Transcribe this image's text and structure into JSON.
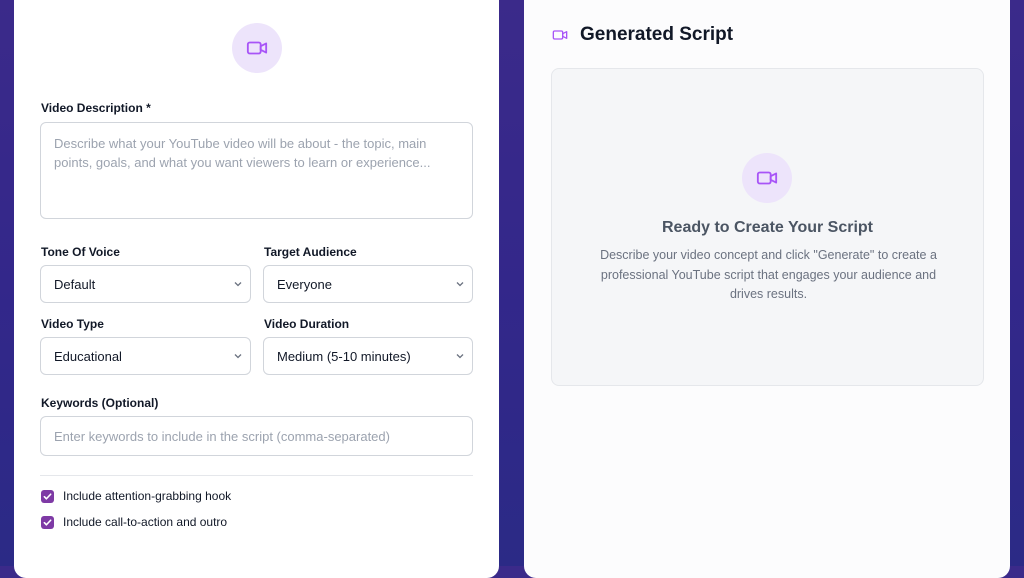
{
  "form": {
    "description": {
      "label": "Video Description *",
      "placeholder": "Describe what your YouTube video will be about - the topic, main points, goals, and what you want viewers to learn or experience..."
    },
    "tone": {
      "label": "Tone Of Voice",
      "value": "Default"
    },
    "audience": {
      "label": "Target Audience",
      "value": "Everyone"
    },
    "type": {
      "label": "Video Type",
      "value": "Educational"
    },
    "duration": {
      "label": "Video Duration",
      "value": "Medium (5-10 minutes)"
    },
    "keywords": {
      "label": "Keywords (Optional)",
      "placeholder": "Enter keywords to include in the script (comma-separated)"
    },
    "options": [
      {
        "label": "Include attention-grabbing hook",
        "checked": true
      },
      {
        "label": "Include call-to-action and outro",
        "checked": true
      }
    ]
  },
  "output": {
    "title": "Generated Script",
    "empty_title": "Ready to Create Your Script",
    "empty_text": "Describe your video concept and click \"Generate\" to create a professional YouTube script that engages your audience and drives results."
  },
  "icons": {
    "header": "video-camera-icon",
    "form": "video-camera-icon",
    "empty": "video-camera-icon"
  },
  "colors": {
    "accent": "#a855f7",
    "checkbox": "#7e3aa5",
    "background": "#34288a",
    "icon_circle": "#ede4fb"
  }
}
